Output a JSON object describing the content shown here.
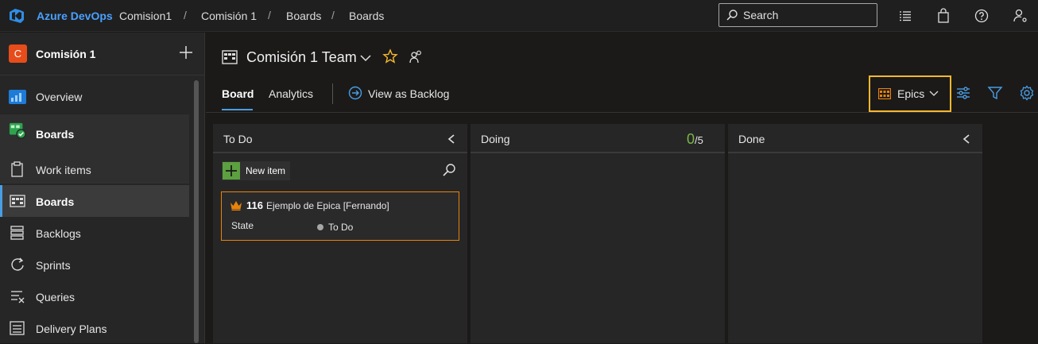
{
  "topbar": {
    "brand": "Azure DevOps",
    "breadcrumbs": [
      "Comision1",
      "Comisión 1",
      "Boards",
      "Boards"
    ],
    "separator": "/",
    "search_placeholder": "Search"
  },
  "sidebar": {
    "project_initial": "C",
    "project_name": "Comisión 1",
    "items": [
      {
        "label": "Overview",
        "icon": "overview-icon"
      },
      {
        "label": "Boards",
        "icon": "boards-hub-icon"
      },
      {
        "label": "Work items",
        "icon": "work-items-icon"
      },
      {
        "label": "Boards",
        "icon": "boards-icon"
      },
      {
        "label": "Backlogs",
        "icon": "backlogs-icon"
      },
      {
        "label": "Sprints",
        "icon": "sprints-icon"
      },
      {
        "label": "Queries",
        "icon": "queries-icon"
      },
      {
        "label": "Delivery Plans",
        "icon": "delivery-plans-icon"
      }
    ]
  },
  "header": {
    "team_title": "Comisión 1 Team",
    "tabs": [
      "Board",
      "Analytics"
    ],
    "view_as_backlog": "View as Backlog",
    "backlog_level": "Epics"
  },
  "board": {
    "columns": [
      {
        "title": "To Do"
      },
      {
        "title": "Doing",
        "wip_current": "0",
        "wip_limit": "/5"
      },
      {
        "title": "Done"
      }
    ],
    "new_item_label": "New item",
    "card": {
      "id": "116",
      "title": "Ejemplo de Epica [Fernando]",
      "field_label": "State",
      "field_value": "To Do"
    }
  },
  "colors": {
    "accent": "#4a9de3",
    "epic_orange": "#e8830b",
    "highlight": "#f5b82e",
    "wip_green": "#7ab648",
    "project_badge": "#e74c1b"
  }
}
